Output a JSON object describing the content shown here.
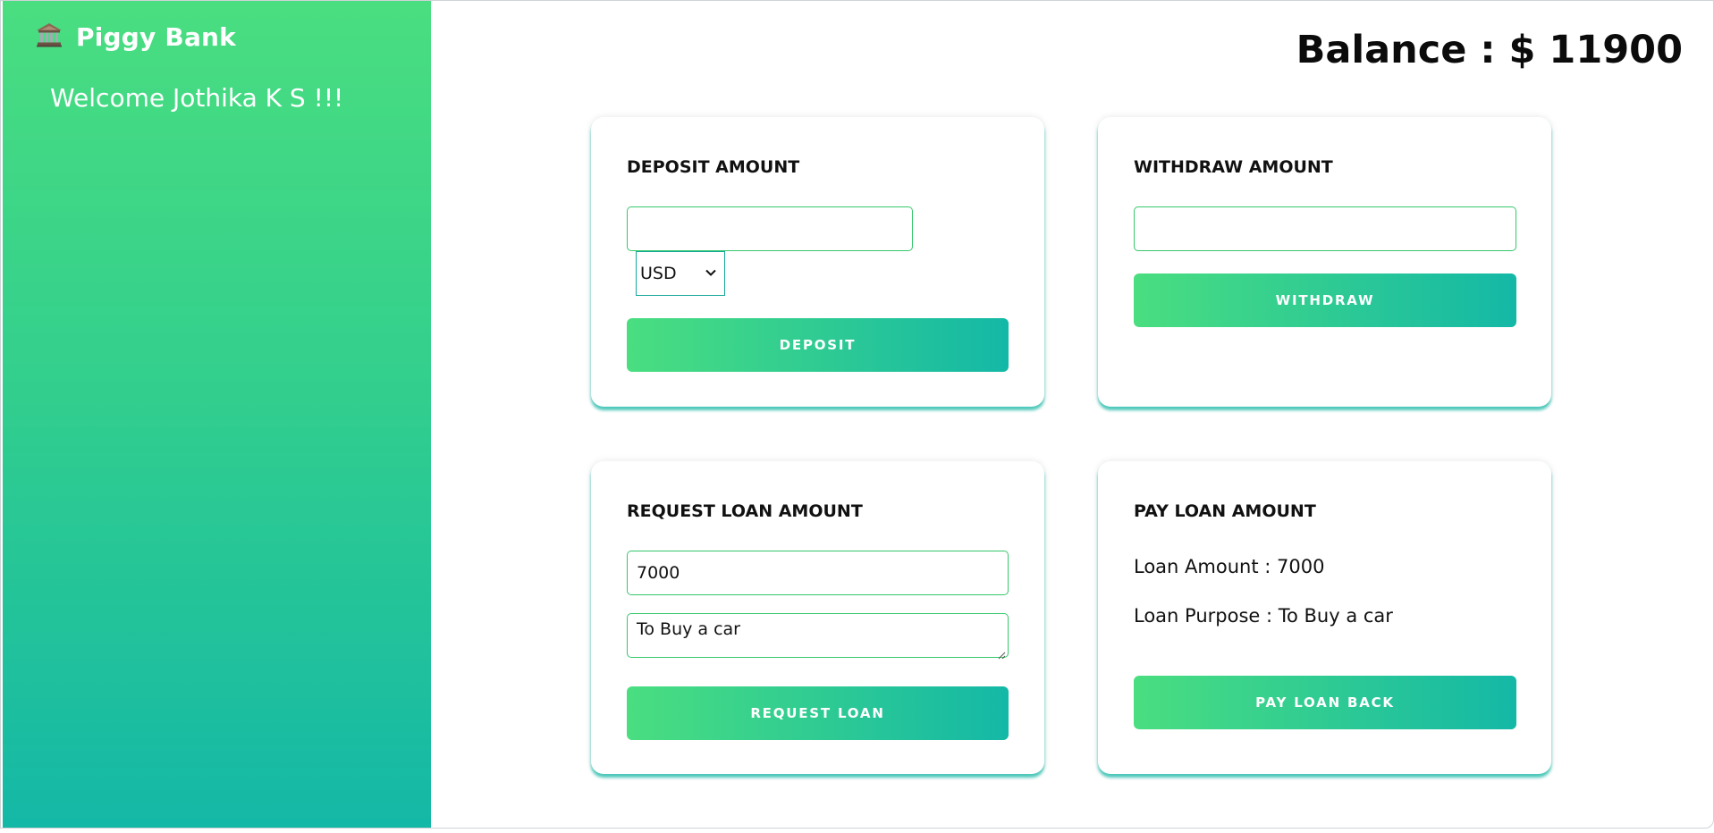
{
  "sidebar": {
    "brand_icon": "bank-icon",
    "brand_name": "Piggy Bank",
    "welcome": "Welcome Jothika K S !!!"
  },
  "header": {
    "balance": "Balance : $ 11900"
  },
  "deposit": {
    "title": "DEPOSIT AMOUNT",
    "amount_value": "",
    "currency_selected": "USD",
    "button_label": "DEPOSIT"
  },
  "withdraw": {
    "title": "WITHDRAW AMOUNT",
    "amount_value": "",
    "button_label": "WITHDRAW"
  },
  "request_loan": {
    "title": "REQUEST LOAN AMOUNT",
    "amount_value": "7000",
    "purpose_value": "To Buy a car",
    "button_label": "REQUEST LOAN"
  },
  "pay_loan": {
    "title": "PAY LOAN AMOUNT",
    "loan_amount": "Loan Amount : 7000",
    "loan_purpose": "Loan Purpose : To Buy a car",
    "button_label": "PAY LOAN BACK"
  },
  "colors": {
    "gradient_start": "#4ade80",
    "gradient_end": "#14b8a6",
    "input_border": "#36c76a"
  }
}
